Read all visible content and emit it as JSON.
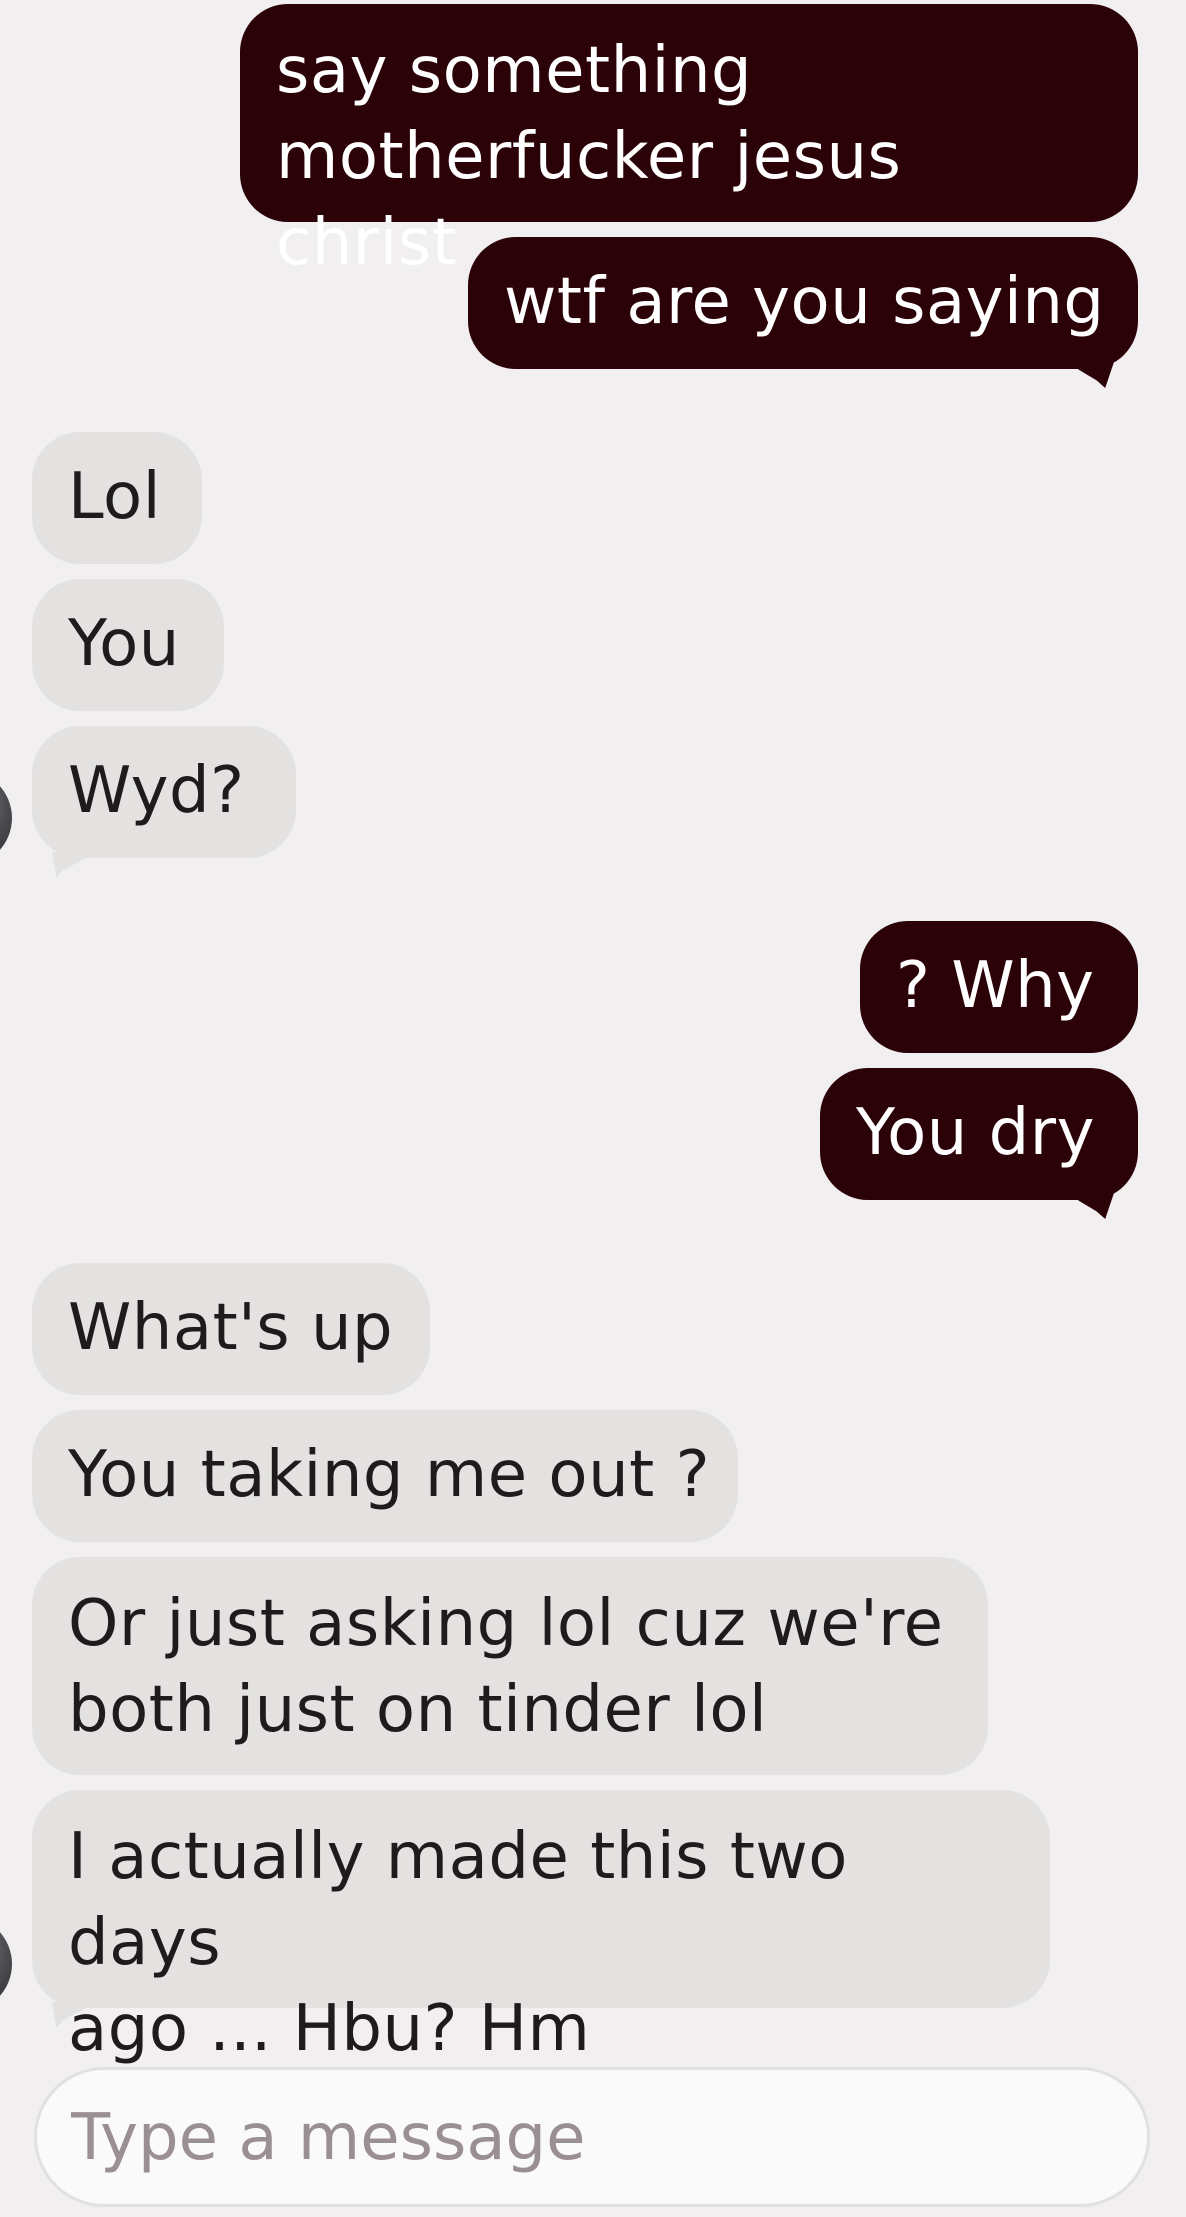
{
  "messages": [
    {
      "side": "sent",
      "text": "say something\nmotherfucker jesus christ"
    },
    {
      "side": "sent",
      "text": "wtf are you saying"
    },
    {
      "side": "recv",
      "text": "Lol"
    },
    {
      "side": "recv",
      "text": "You"
    },
    {
      "side": "recv",
      "text": "Wyd?"
    },
    {
      "side": "sent",
      "text": "? Why"
    },
    {
      "side": "sent",
      "text": "You dry"
    },
    {
      "side": "recv",
      "text": "What's up"
    },
    {
      "side": "recv",
      "text": "You taking me out ?"
    },
    {
      "side": "recv",
      "text": "Or just asking lol cuz we're\nboth just on tinder lol"
    },
    {
      "side": "recv",
      "text": "I actually made this two days\nago ... Hbu? Hm"
    }
  ],
  "composer": {
    "placeholder": "Type a message",
    "value": ""
  },
  "colors": {
    "sent_bubble": "#2b0208",
    "received_bubble": "#e3e2e1",
    "background": "#f1eff0"
  }
}
